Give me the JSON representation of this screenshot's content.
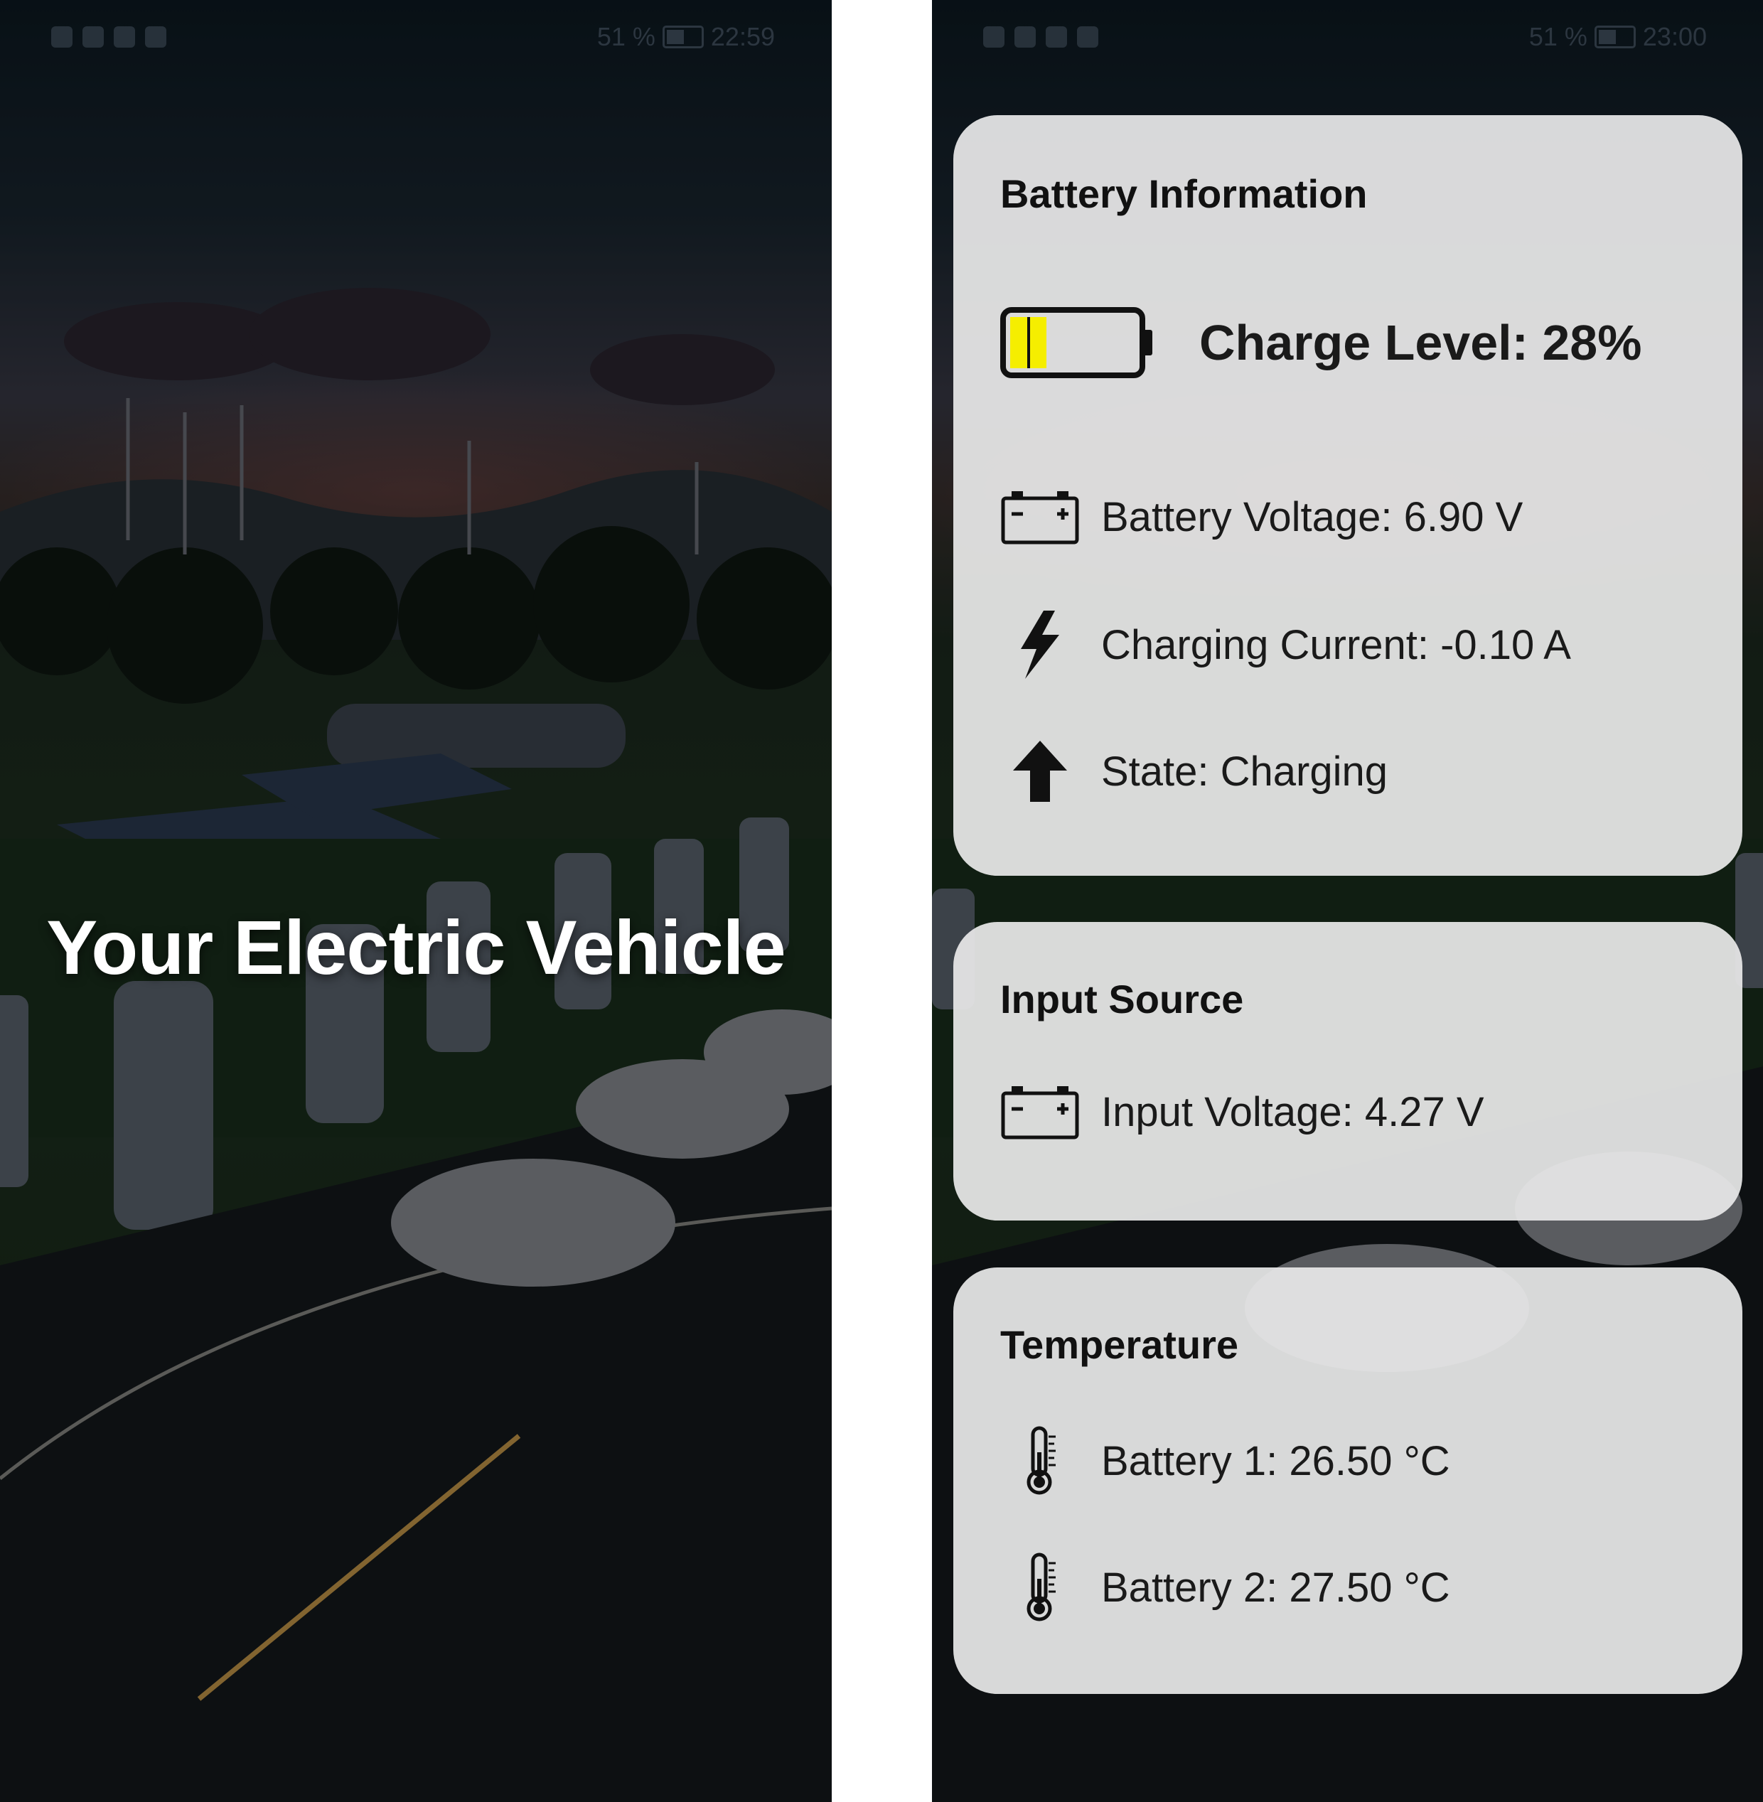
{
  "left_screen": {
    "status": {
      "battery_percent": "51 %",
      "time": "22:59"
    },
    "hero_title": "Your Electric Vehicle"
  },
  "right_screen": {
    "status": {
      "battery_percent": "51 %",
      "time": "23:00"
    },
    "battery_card": {
      "title": "Battery Information",
      "charge_level": "Charge Level: 28%",
      "charge_fraction": 0.28,
      "voltage": "Battery Voltage: 6.90 V",
      "current": "Charging Current: -0.10 A",
      "state": "State: Charging"
    },
    "input_card": {
      "title": "Input Source",
      "voltage": "Input Voltage: 4.27 V"
    },
    "temperature_card": {
      "title": "Temperature",
      "battery1": "Battery 1: 26.50 °C",
      "battery2": "Battery 2: 27.50 °C"
    }
  },
  "colors": {
    "charge_fill": "#f5ee00",
    "card_bg": "#e8e8e8"
  },
  "icons": [
    "battery-level-icon",
    "car-battery-icon",
    "lightning-bolt-icon",
    "arrow-up-icon",
    "thermometer-icon"
  ]
}
